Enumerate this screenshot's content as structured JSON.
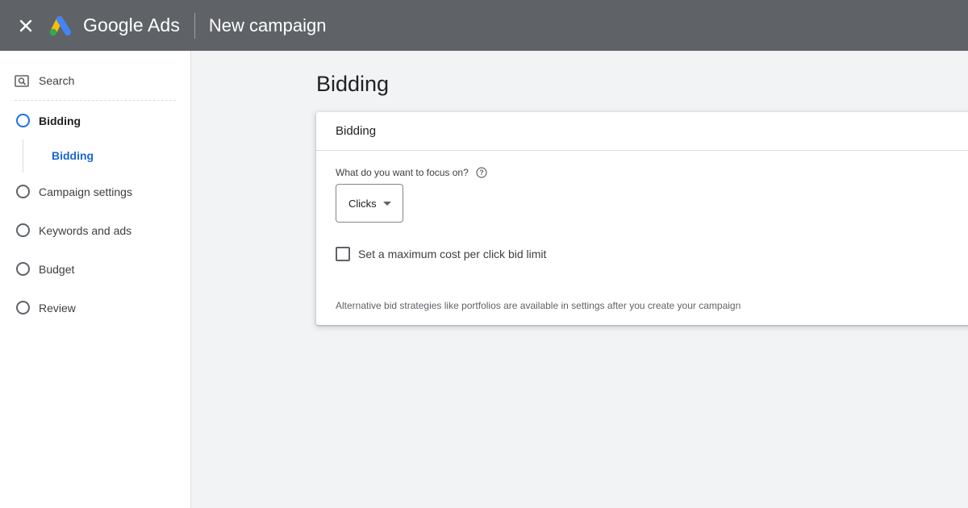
{
  "topbar": {
    "app_name": "Google Ads",
    "page_title": "New campaign"
  },
  "icons": {
    "close": "close-icon",
    "logo": "google-ads-logo",
    "search": "search-icon",
    "help": "help-icon",
    "dropdown": "dropdown-arrow-icon"
  },
  "colors": {
    "topbar_bg": "#5f6368",
    "accent_blue": "#1a73e8",
    "active_sub": "#1967d2",
    "logo_blue": "#4285f4",
    "logo_yellow": "#fbbc04",
    "logo_green": "#34a853"
  },
  "sidebar": {
    "search_label": "Search",
    "steps": [
      {
        "label": "Bidding",
        "active": true
      },
      {
        "label": "Campaign settings",
        "active": false
      },
      {
        "label": "Keywords and ads",
        "active": false
      },
      {
        "label": "Budget",
        "active": false
      },
      {
        "label": "Review",
        "active": false
      }
    ],
    "substep": "Bidding"
  },
  "main": {
    "heading": "Bidding",
    "card": {
      "title": "Bidding",
      "focus_question": "What do you want to focus on?",
      "focus_value": "Clicks",
      "checkbox_label": "Set a maximum cost per click bid limit",
      "checkbox_checked": false,
      "footnote": "Alternative bid strategies like portfolios are available in settings after you create your campaign"
    }
  }
}
